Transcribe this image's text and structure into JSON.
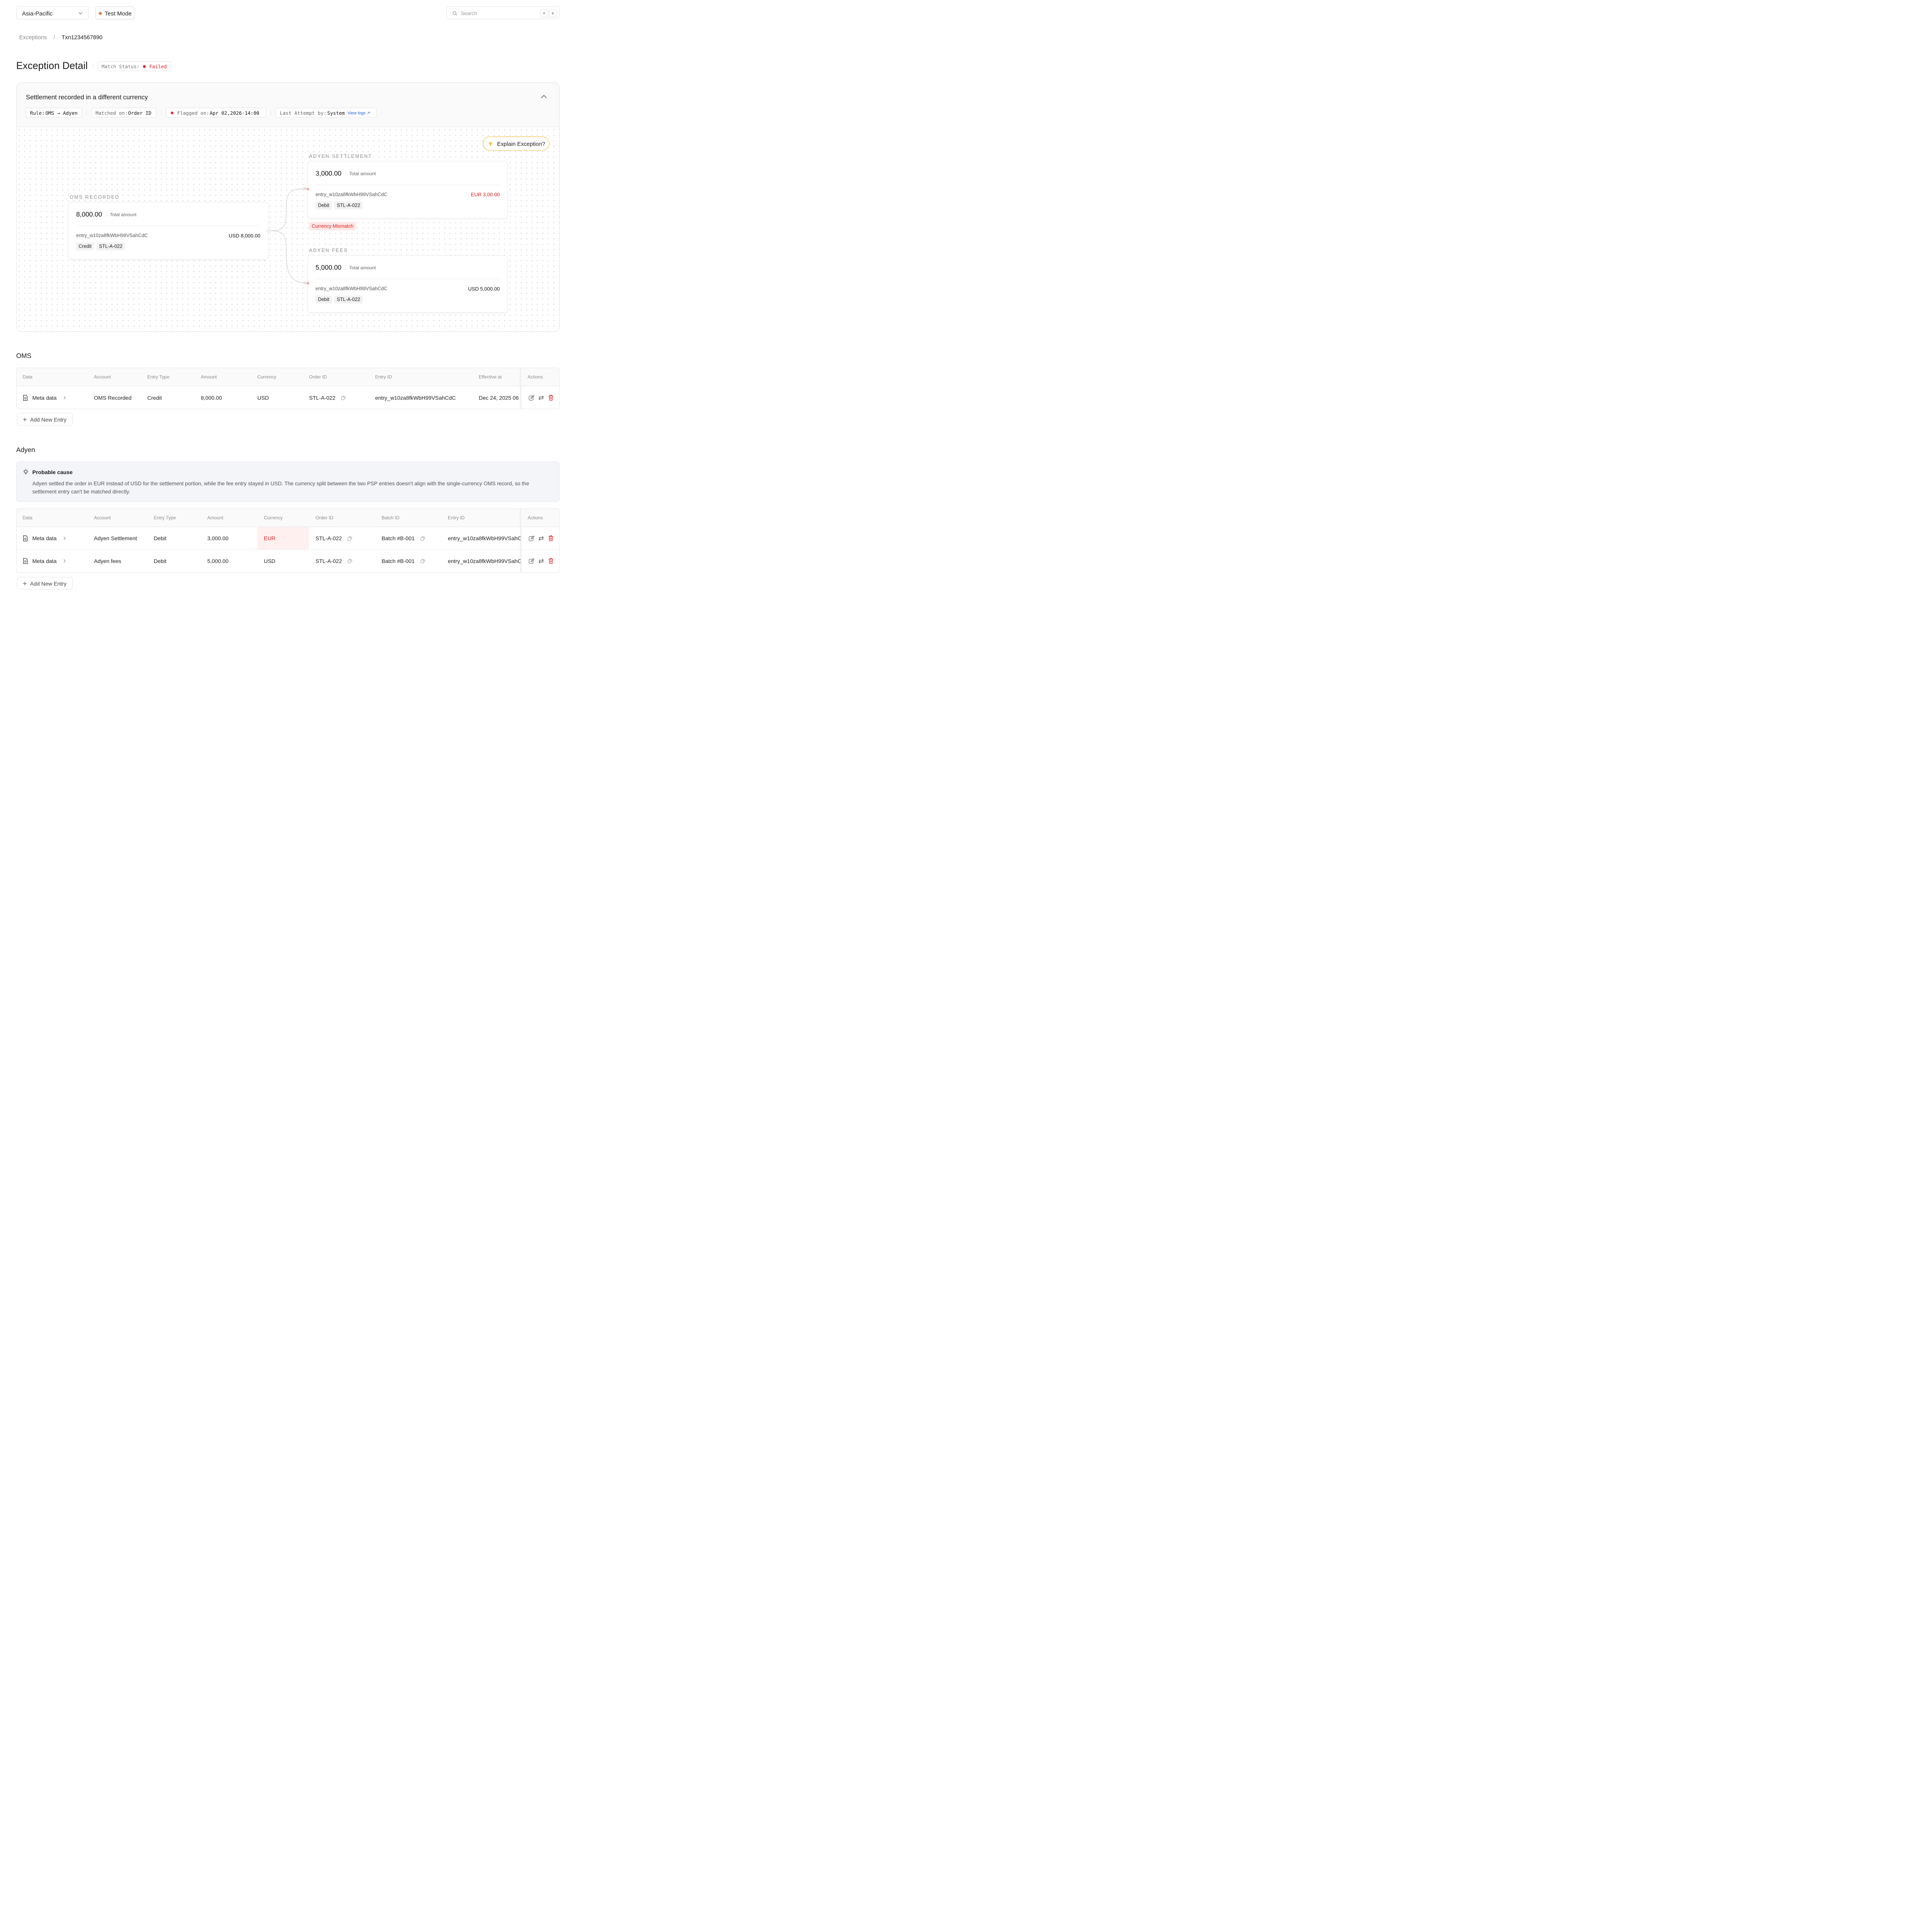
{
  "topbar": {
    "region": "Asia-Pacific",
    "mode": "Test Mode",
    "search_placeholder": "Search",
    "kbd_cmd": "⌘",
    "kbd_k": "K"
  },
  "breadcrumb": {
    "parent": "Exceptions",
    "current": "Txn1234567890"
  },
  "page": {
    "title": "Exception Detail",
    "status_label": "Match Status:",
    "status_value": "Failed"
  },
  "exception": {
    "heading": "Settlement recorded in a different currency",
    "rule_label": "Rule:",
    "rule_value": "OMS → Adyen",
    "matched_label": "Matched on:",
    "matched_value": "Order ID",
    "flagged_label": "Flagged on:",
    "flagged_value": "Apr 02,2026·14:00",
    "attempt_label": "Last Attempt by:",
    "attempt_value": "System",
    "view_logs": "View logs ↗",
    "explain_button": "Explain Exception?"
  },
  "flow": {
    "oms": {
      "section": "OMS RECORDED",
      "total": "8,000.00",
      "total_label": "Total amount",
      "entry": "entry_w10za8fkWbH99VSahCdC",
      "amount": "USD 8,000.00",
      "type": "Credit",
      "ref": "STL-A-022"
    },
    "settlement": {
      "section": "ADYEN SETTLEMENT",
      "total": "3,000.00",
      "total_label": "Total amount",
      "entry": "entry_w10za8fkWbH99VSahCdC",
      "amount": "EUR 3,00.00",
      "type": "Debit",
      "ref": "STL-A-022",
      "flag": "Currency Mismatch"
    },
    "fees": {
      "section": "ADYEN FEES",
      "total": "5,000.00",
      "total_label": "Total amount",
      "entry": "entry_w10za8fkWbH99VSahCdC",
      "amount": "USD 5,000.00",
      "type": "Debit",
      "ref": "STL-A-022"
    }
  },
  "oms_table": {
    "title": "OMS",
    "headers": [
      "Data",
      "Account",
      "Entry Type",
      "Amount",
      "Currency",
      "Order ID",
      "Entry ID",
      "Effective at",
      "Actions"
    ],
    "rows": [
      {
        "data": "Meta data",
        "account": "OMS Recorded",
        "type": "Credit",
        "amount": "8,000.00",
        "currency": "USD",
        "order": "STL-A-022",
        "entry": "entry_w10za8fkWbH99VSahCdC",
        "effective": "Dec 24, 2025 06"
      }
    ],
    "add_label": "Add New Entry"
  },
  "adyen_table": {
    "title": "Adyen",
    "cause_title": "Probable cause",
    "cause_text": "Adyen settled the order in EUR instead of USD for the settlement portion, while the fee entry stayed in USD. The currency split between the two PSP entries doesn't align with the single-currency OMS record, so the settlement entry can't be matched directly.",
    "headers": [
      "Data",
      "Account",
      "Entry Type",
      "Amount",
      "Currency",
      "Order ID",
      "Batch ID",
      "Entry ID",
      "Actions"
    ],
    "rows": [
      {
        "data": "Meta data",
        "account": "Adyen Settlement",
        "type": "Debit",
        "amount": "3,000.00",
        "currency": "EUR",
        "order": "STL-A-022",
        "batch": "Batch #B-001",
        "entry": "entry_w10za8fkWbH99VSahC"
      },
      {
        "data": "Meta data",
        "account": "Adyen fees",
        "type": "Debit",
        "amount": "5,000.00",
        "currency": "USD",
        "order": "STL-A-022",
        "batch": "Batch #B-001",
        "entry": "entry_w10za8fkWbH99VSahC"
      }
    ],
    "add_label": "Add New Entry"
  },
  "colors": {
    "fail": "#dd1d1d",
    "test_dot": "#e07b3a",
    "link": "#1f63c9",
    "explain_border": "#f4c55a"
  }
}
